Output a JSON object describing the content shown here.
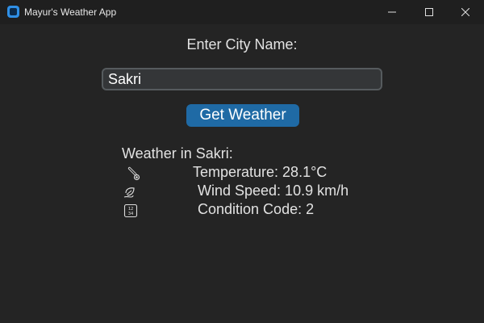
{
  "window": {
    "title": "Mayur's Weather App"
  },
  "form": {
    "city_label": "Enter City Name:",
    "city_value": "Sakri",
    "button_label": "Get Weather"
  },
  "weather": {
    "heading": "Weather in Sakri:",
    "temperature": "Temperature: 28.1°C",
    "wind_speed": "Wind Speed: 10.9 km/h",
    "condition_code": "Condition Code: 2"
  },
  "icons": {
    "app": "app-icon",
    "temperature": "thermometer-icon",
    "wind": "wind-leaf-icon",
    "condition": "numbers-icon"
  },
  "colors": {
    "background": "#242424",
    "titlebar": "#1f1f1f",
    "button": "#1f6aa5",
    "input_bg": "#343638",
    "input_border": "#565b5e"
  }
}
